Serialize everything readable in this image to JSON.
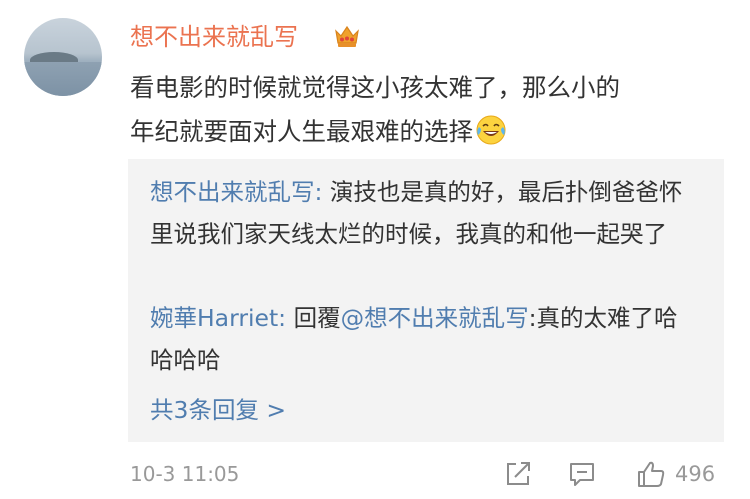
{
  "comment": {
    "username": "想不出来就乱写",
    "text": "看电影的时候就觉得这小孩太难了，那么小的年纪就要面对人生最艰难的选择",
    "badge_icon": "crown-icon",
    "emoji_icon": "laugh-cry-emoji-icon",
    "timestamp": "10-3 11:05",
    "like_count": "496",
    "colors": {
      "username": "#eb7350",
      "link": "#507daf",
      "meta": "#999999",
      "reply_bg": "#f3f3f3"
    }
  },
  "replies": [
    {
      "author": "想不出来就乱写:",
      "text": " 演技也是真的好，最后扑倒爸爸怀里说我们家天线太烂的时候，我真的和他一起哭了"
    },
    {
      "author": "婉華Harriet:",
      "prefix": " 回覆",
      "mention": "@想不出来就乱写",
      "text": ":真的太难了哈哈哈哈"
    }
  ],
  "more_replies_label": "共3条回复 >",
  "actions": {
    "share_icon": "share-icon",
    "comment_icon": "comment-icon",
    "like_icon": "thumbs-up-icon"
  }
}
